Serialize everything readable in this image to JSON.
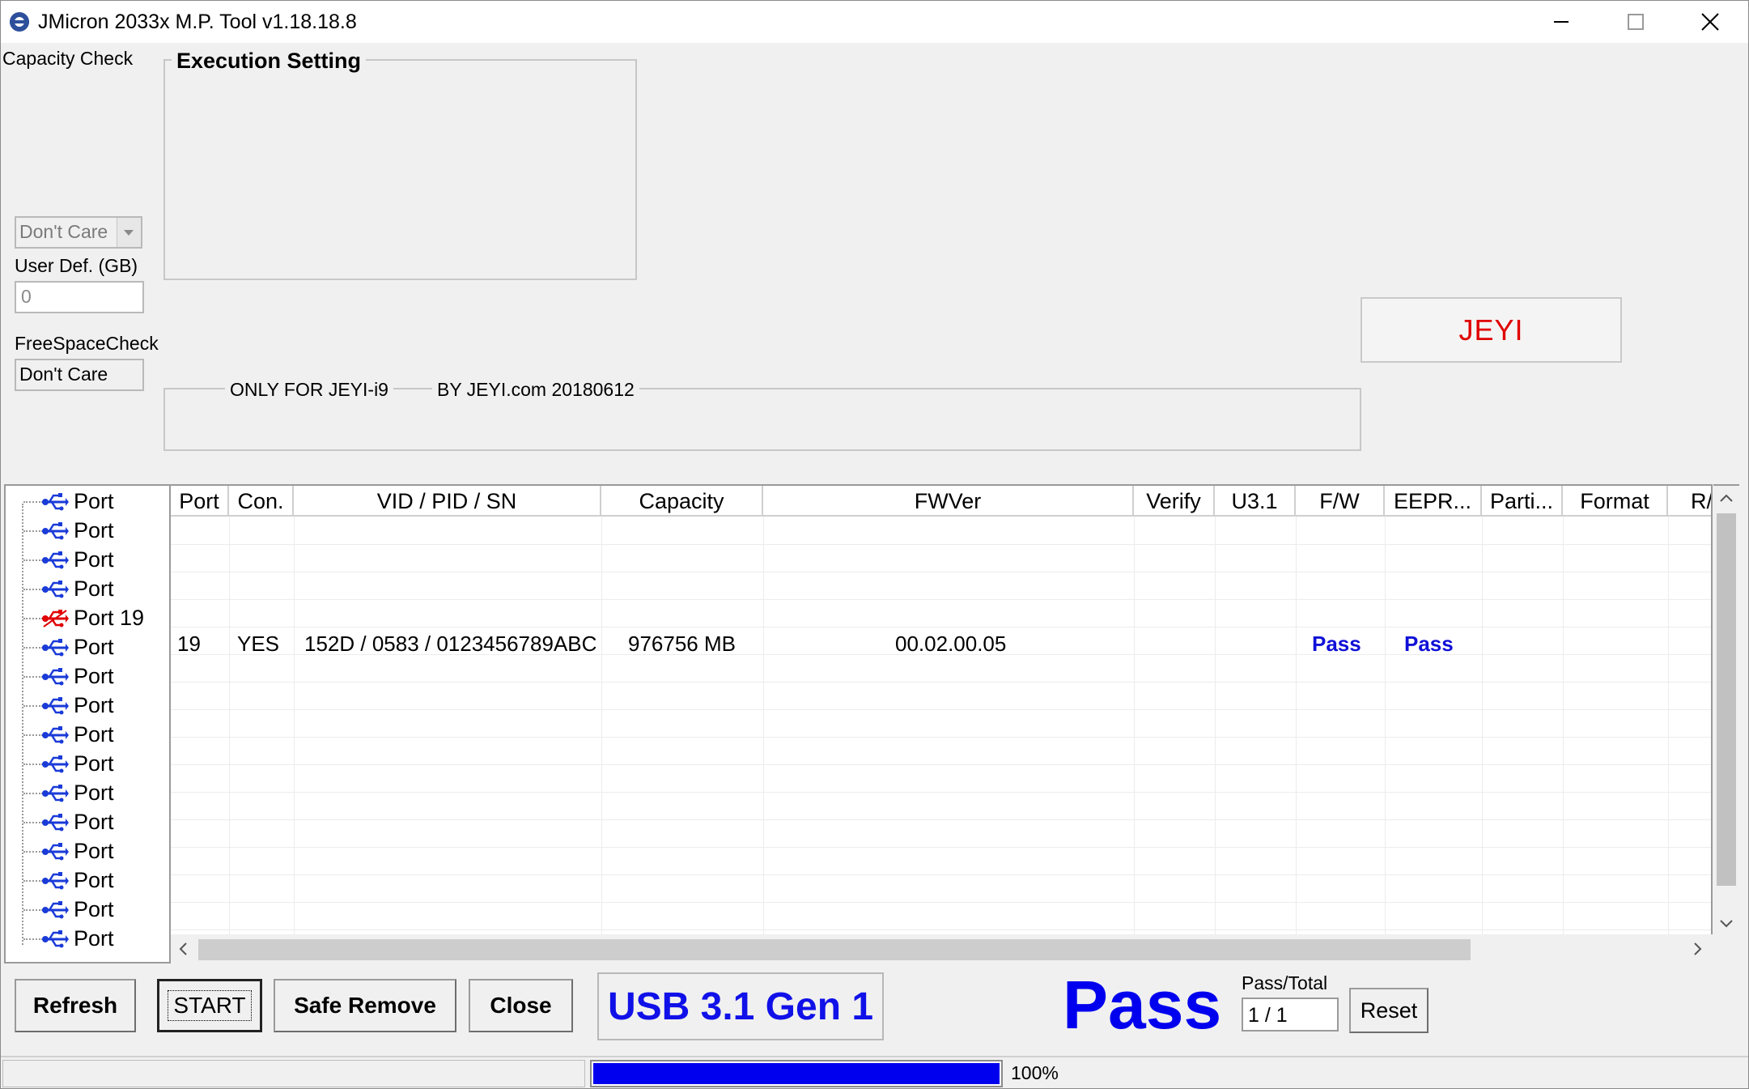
{
  "window": {
    "title": "JMicron 2033x M.P. Tool v1.18.18.8"
  },
  "left_panel": {
    "capacity_check_label": "Capacity Check",
    "capacity_select_value": "Don't Care",
    "user_def_label": "User Def. (GB)",
    "user_def_value": "0",
    "free_space_label": "FreeSpaceCheck",
    "free_space_value": "Don't Care"
  },
  "execution_setting": {
    "title": "Execution Setting"
  },
  "info_group": {
    "only_for": "ONLY FOR JEYI-i9",
    "by": "BY JEYI.com  20180612"
  },
  "brand_button": {
    "label": "JEYI"
  },
  "tree": {
    "items": [
      {
        "label": "Port",
        "state": "normal"
      },
      {
        "label": "Port",
        "state": "normal"
      },
      {
        "label": "Port",
        "state": "normal"
      },
      {
        "label": "Port",
        "state": "normal"
      },
      {
        "label": "Port 19",
        "state": "active"
      },
      {
        "label": "Port",
        "state": "normal"
      },
      {
        "label": "Port",
        "state": "normal"
      },
      {
        "label": "Port",
        "state": "normal"
      },
      {
        "label": "Port",
        "state": "normal"
      },
      {
        "label": "Port",
        "state": "normal"
      },
      {
        "label": "Port",
        "state": "normal"
      },
      {
        "label": "Port",
        "state": "normal"
      },
      {
        "label": "Port",
        "state": "normal"
      },
      {
        "label": "Port",
        "state": "normal"
      },
      {
        "label": "Port",
        "state": "normal"
      },
      {
        "label": "Port",
        "state": "normal"
      }
    ]
  },
  "grid": {
    "columns": [
      "Port",
      "Con.",
      "VID / PID / SN",
      "Capacity",
      "FWVer",
      "Verify",
      "U3.1",
      "F/W",
      "EEPR...",
      "Parti...",
      "Format",
      "R/"
    ],
    "row": {
      "port": "19",
      "con": "YES",
      "vid_pid_sn": "152D / 0583 / 0123456789ABC",
      "capacity": "976756 MB",
      "fwver": "00.02.00.05",
      "fw": "Pass",
      "eeprom": "Pass"
    }
  },
  "buttons": {
    "refresh": "Refresh",
    "start": "START",
    "safe_remove": "Safe Remove",
    "close": "Close",
    "reset": "Reset"
  },
  "status": {
    "usb_mode": "USB 3.1 Gen 1",
    "result": "Pass",
    "pass_total_label": "Pass/Total",
    "pass_total_value": "1 / 1",
    "progress": 100,
    "progress_text": "100%"
  },
  "colors": {
    "pass": "#1010d8",
    "brand": "#e00000",
    "progress": "#0000ee"
  }
}
